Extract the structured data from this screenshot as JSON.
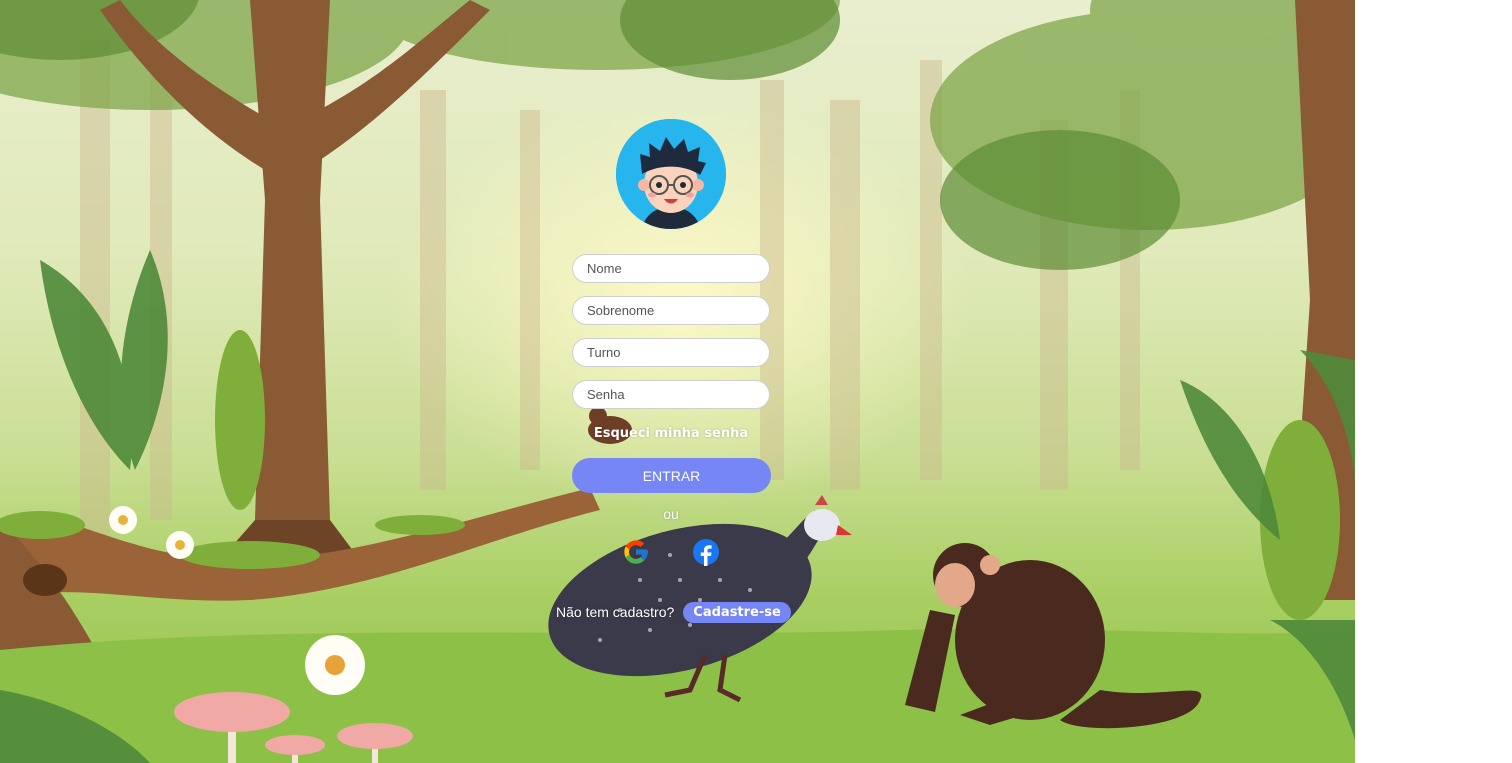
{
  "login": {
    "fields": {
      "first_name_placeholder": "Nome",
      "last_name_placeholder": "Sobrenome",
      "shift_placeholder": "Turno",
      "password_placeholder": "Senha"
    },
    "forgot_password": "Esqueci minha senha",
    "submit_label": "ENTRAR",
    "divider": "ou",
    "social": [
      "google-icon",
      "facebook-icon"
    ],
    "signup": {
      "prompt": "Não tem cadastro?",
      "button": "Cadastre-se"
    }
  },
  "colors": {
    "accent": "#7686f4",
    "facebook": "#1877f2",
    "avatar_bg": "#27b5ee"
  }
}
